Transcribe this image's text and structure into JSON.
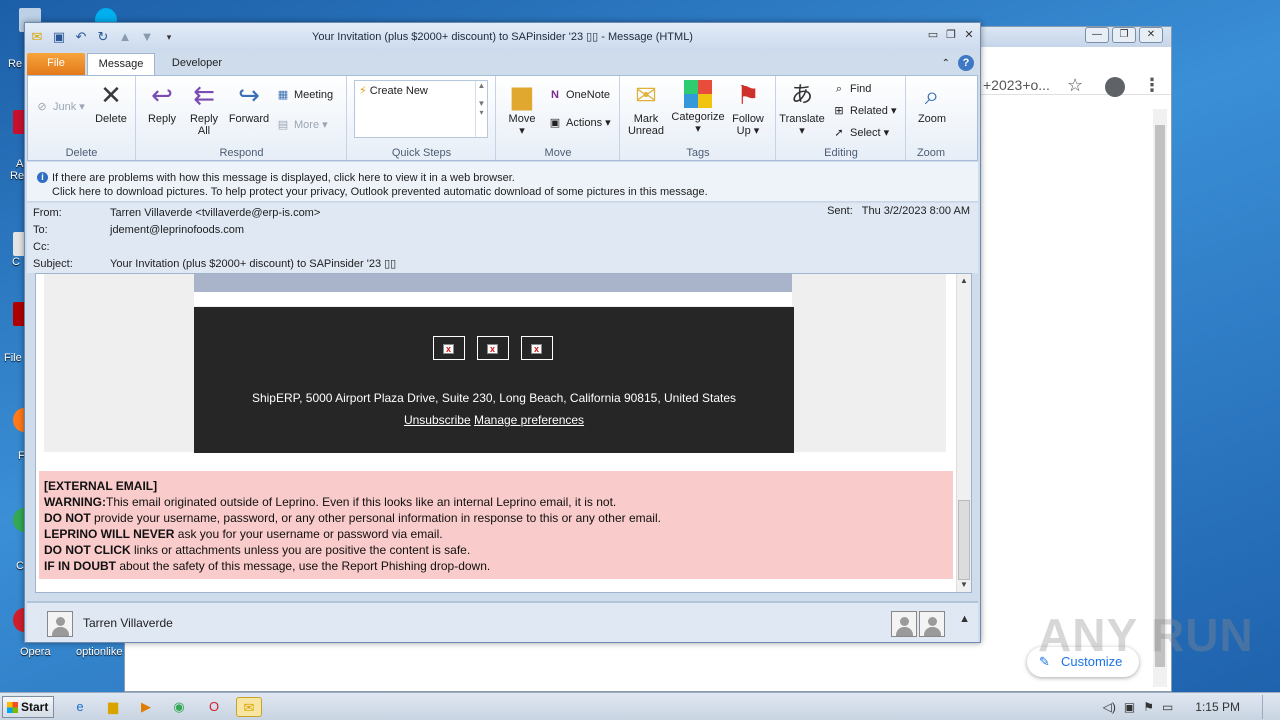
{
  "desktop": {
    "labels": [
      "Re",
      "A",
      "Re",
      "C",
      "File",
      "F",
      "C",
      "Opera",
      "optionlike"
    ]
  },
  "browser": {
    "omnibox_tail": "+2023+o...",
    "customize_label": "Customize",
    "watermark": "ANY RUN"
  },
  "window": {
    "title": "Your Invitation (plus $2000+ discount) to SAPinsider '23 ▯▯ - Message (HTML)"
  },
  "tabs": [
    {
      "label": "File"
    },
    {
      "label": "Message"
    },
    {
      "label": "Developer"
    }
  ],
  "ribbon": {
    "delete_group": {
      "junk": "Junk",
      "delete": "Delete",
      "label": "Delete"
    },
    "respond_group": {
      "reply": "Reply",
      "reply_all_1": "Reply",
      "reply_all_2": "All",
      "forward": "Forward",
      "meeting": "Meeting",
      "more": "More",
      "label": "Respond"
    },
    "quick_steps": {
      "create_new": "Create New",
      "label": "Quick Steps"
    },
    "move_group": {
      "move": "Move",
      "onenote": "OneNote",
      "actions": "Actions",
      "label": "Move"
    },
    "tags_group": {
      "mark_unread_1": "Mark",
      "mark_unread_2": "Unread",
      "categorize": "Categorize",
      "follow_up_1": "Follow",
      "follow_up_2": "Up",
      "label": "Tags"
    },
    "editing_group": {
      "translate": "Translate",
      "find": "Find",
      "related": "Related",
      "select": "Select",
      "label": "Editing"
    },
    "zoom_group": {
      "zoom": "Zoom",
      "label": "Zoom"
    }
  },
  "infobar": {
    "line1": "If there are problems with how this message is displayed, click here to view it in a web browser.",
    "line2": "Click here to download pictures. To help protect your privacy, Outlook prevented automatic download of some pictures in this message."
  },
  "headers": {
    "from_label": "From:",
    "from": "Tarren Villaverde <tvillaverde@erp-is.com>",
    "to_label": "To:",
    "to": "jdement@leprinofoods.com",
    "cc_label": "Cc:",
    "cc": "",
    "subject_label": "Subject:",
    "subject": "Your Invitation (plus $2000+ discount) to SAPinsider '23 ▯▯",
    "sent_label": "Sent:",
    "sent": "Thu 3/2/2023 8:00 AM"
  },
  "mail": {
    "address": "ShipERP, 5000 Airport Plaza Drive, Suite 230, Long Beach, California 90815, United States",
    "unsubscribe": "Unsubscribe",
    "manage": "Manage preferences"
  },
  "warning": {
    "l1": "[EXTERNAL EMAIL]",
    "l2_b": "WARNING:",
    "l2": "This email originated outside of Leprino. Even if this looks like an internal Leprino email, it is not.",
    "l3_b": "DO NOT",
    "l3": " provide your username, password, or any other personal information in response to this or any other email.",
    "l4_b": "LEPRINO WILL NEVER",
    "l4": " ask you for your username or password via email.",
    "l5_b": "DO NOT CLICK",
    "l5": " links or attachments unless you are positive the content is safe.",
    "l6_b": "IF IN DOUBT",
    "l6": " about the safety of this message, use the Report Phishing drop-down."
  },
  "people_pane": {
    "name": "Tarren Villaverde"
  },
  "taskbar": {
    "start": "Start",
    "clock": "1:15 PM"
  },
  "colors": {
    "file_tab": "#e3791a",
    "warning_bg": "#f9cbcb",
    "footer_dark": "#262626"
  }
}
